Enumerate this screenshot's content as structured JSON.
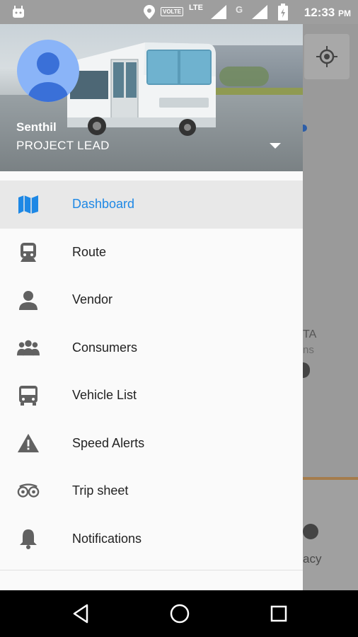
{
  "status_bar": {
    "time": "12:33",
    "ampm": "PM",
    "volte": "VOLTE",
    "lte": "LTE",
    "network_g": "G"
  },
  "drawer": {
    "user_name": "Senthil",
    "user_role": "PROJECT LEAD",
    "items": [
      {
        "label": "Dashboard",
        "icon": "map-icon",
        "active": true
      },
      {
        "label": "Route",
        "icon": "train-icon"
      },
      {
        "label": "Vendor",
        "icon": "person-icon"
      },
      {
        "label": "Consumers",
        "icon": "group-icon"
      },
      {
        "label": "Vehicle List",
        "icon": "bus-icon"
      },
      {
        "label": "Speed Alerts",
        "icon": "warning-icon"
      },
      {
        "label": "Trip sheet",
        "icon": "tripadvisor-icon"
      },
      {
        "label": "Notifications",
        "icon": "bell-icon"
      }
    ]
  },
  "background": {
    "text_ta": "TA",
    "text_ns": "ns",
    "text_acy": "acy"
  },
  "colors": {
    "accent": "#1e88e5",
    "icon": "#616161",
    "avatar": "#8ab4f8"
  }
}
